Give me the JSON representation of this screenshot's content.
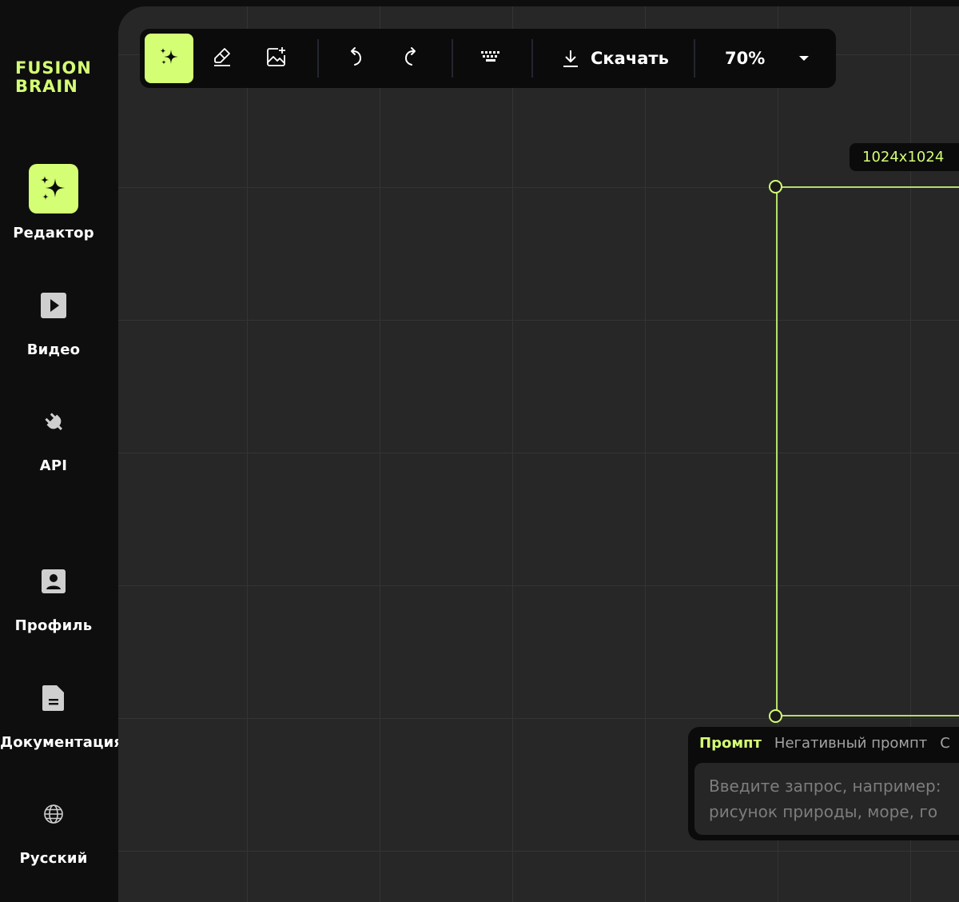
{
  "sidebar": {
    "logo_line1": "FUSION",
    "logo_line2": "BRAIN",
    "items": [
      {
        "label": "Редактор",
        "icon": "sparkles-icon",
        "active": true
      },
      {
        "label": "Видео",
        "icon": "play-icon"
      },
      {
        "label": "API",
        "icon": "plug-icon"
      },
      {
        "label": "Профиль",
        "icon": "profile-icon"
      },
      {
        "label": "Документация",
        "icon": "document-icon"
      },
      {
        "label": "Русский",
        "icon": "globe-icon"
      }
    ]
  },
  "toolbar": {
    "tools": [
      "sparkles-icon",
      "eraser-icon",
      "image-add-icon",
      "undo-icon",
      "redo-icon",
      "keyboard-icon"
    ],
    "download_label": "Скачать",
    "zoom": "70%"
  },
  "frame": {
    "size_label": "1024x1024"
  },
  "prompt": {
    "tabs": [
      "Промпт",
      "Негативный промпт",
      "С"
    ],
    "active_tab": "Промпт",
    "placeholder": "Введите запрос, например: рисунок природы, море, го"
  },
  "colors": {
    "accent": "#d4fe74",
    "sidebar_bg": "#0e0e0e",
    "canvas_bg": "#272727",
    "toolbar_bg": "#0b0b0b"
  }
}
